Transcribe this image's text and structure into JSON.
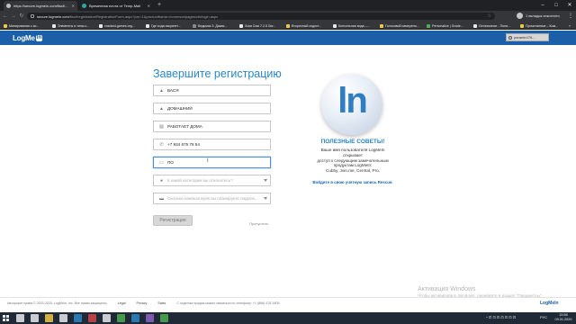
{
  "browser": {
    "tabs": [
      {
        "title": "https://secure.logmein.com/fiscf/..."
      },
      {
        "title": "Временная почта от Temp-Mail"
      }
    ],
    "new_tab": "+",
    "window_controls": [
      "–",
      "□",
      "✕"
    ],
    "address": {
      "host": "secure.logmein.com",
      "path": "/fiscf/registration/RegistrationForm.aspx?prn=1&productframe=/common/pages/cfs/login.aspx"
    },
    "profile_text": "1 вкладка инкогнито",
    "bookmarks": [
      {
        "label": "Минирования с ас...",
        "color": "#f2c744"
      },
      {
        "label": "Элементы и типы с...",
        "color": "#e8eaed"
      },
      {
        "label": "cracked-games.org...",
        "color": "#e8eaed"
      },
      {
        "label": "Где хода искуснет...",
        "color": "#e8eaed"
      },
      {
        "label": "Ведьмак 3: Дикая...",
        "color": "#8a8a8a"
      },
      {
        "label": "Хоки Сим 7.2.5 Лиг...",
        "color": "#e8eaed"
      },
      {
        "label": "Вторичный ходост...",
        "color": "#f2c744"
      },
      {
        "label": "Консольная вода –...",
        "color": "#e8eaed"
      },
      {
        "label": "Голосовой измерени...",
        "color": "#f2c744"
      },
      {
        "label": "Personalize | Grade...",
        "color": "#4caf50"
      },
      {
        "label": "Geneseance - Пони...",
        "color": "#e8eaed"
      },
      {
        "label": "Прочитанные – Ком...",
        "color": "#f2c744"
      }
    ],
    "bookmarks_overflow": "»"
  },
  "page": {
    "logo_text": "LogMe",
    "logo_box": "In",
    "account_badge": "paramir476...",
    "form": {
      "title": "Завершите регистрацию",
      "first_name": "ВАСЯ",
      "last_name": "ДОМАШНИЙ",
      "company": "РАБОТАЕТ ДОМА",
      "phone": "+7 934 675 78 54",
      "job_title": "ПО",
      "category_placeholder": "К какой категории вы относитесь?",
      "computers_placeholder": "Сколько компьютеров вы планируете подклю...",
      "register_label": "Регистрация",
      "skip_label": "Пропустить"
    },
    "tips": {
      "logo_letters": "ln",
      "title": "ПОЛЕЗНЫЕ СОВЕТЫ!",
      "line1": "Ваше имя пользователя LogMeIn",
      "line2": "открывает",
      "line3": "доступ к следующим замечательным",
      "line4": "продуктам LogMeIn:",
      "line5": "Cubby, Join.me, Central, Pro.",
      "link": "Войдите в свою учетную запись Rescue."
    },
    "footer": {
      "copyright": "Авторские права © 2003-2020, LogMeIn, Inc. Все права защищены",
      "legal": "Legal",
      "privacy": "Privacy",
      "sales": "Sales",
      "contact": "С отделом продаж можно связаться по телефону: +1 (866) 478-1805",
      "logo": "LogMeIn"
    },
    "watermark": {
      "line1": "Активация Windows",
      "line2": "Чтобы активировать Windows, перейдите в раздел \"Параметры\"."
    }
  },
  "taskbar": {
    "icons": [
      {
        "name": "search",
        "color": "#e8eaed"
      },
      {
        "name": "task-view",
        "color": "#e8eaed"
      },
      {
        "name": "explorer",
        "color": "#f2c744"
      },
      {
        "name": "store",
        "color": "#e8eaed"
      },
      {
        "name": "mail",
        "color": "#2a86c7"
      },
      {
        "name": "app-red",
        "color": "#d64545"
      },
      {
        "name": "media",
        "color": "#e8eaed"
      },
      {
        "name": "chrome",
        "color": "#4caf50"
      },
      {
        "name": "steam",
        "color": "#2a86c7"
      },
      {
        "name": "app-purple",
        "color": "#8e63c7"
      },
      {
        "name": "app-green",
        "color": "#4caf50"
      }
    ],
    "tray_text": "^ ⊡ ⊡ ⊡ ⊡ ⊡ ⊡ ⊡",
    "lang": "РУС",
    "time": "15:56",
    "date": "09.01.2020"
  }
}
